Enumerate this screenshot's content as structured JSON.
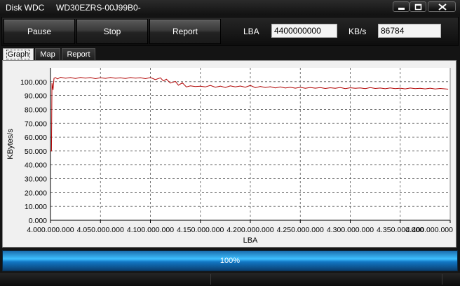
{
  "window": {
    "title": "Disk WDC     WD30EZRS-00J99B0-",
    "minimize_icon": "minimize-icon",
    "maximize_icon": "maximize-icon",
    "close_icon": "close-icon"
  },
  "toolbar": {
    "pause_label": "Pause",
    "stop_label": "Stop",
    "report_label": "Report",
    "lba_label": "LBA",
    "lba_value": "4400000000",
    "kbs_label": "KB/s",
    "kbs_value": "86784"
  },
  "tabs": [
    {
      "label": "Graph",
      "active": true
    },
    {
      "label": "Map",
      "active": false
    },
    {
      "label": "Report",
      "active": false
    }
  ],
  "chart_data": {
    "type": "line",
    "title": "",
    "xlabel": "LBA",
    "ylabel": "KBytes/s",
    "xlim": [
      4000000000,
      4400000000
    ],
    "ylim": [
      0,
      110000
    ],
    "grid": true,
    "x_tick_labels": [
      "4.000.000.000",
      "4.050.000.000",
      "4.100.000.000",
      "4.150.000.000",
      "4.200.000.000",
      "4.250.000.000",
      "4.300.000.000",
      "4.350.000.000",
      "4.400.000.000"
    ],
    "y_tick_labels": [
      "0.000",
      "10.000",
      "20.000",
      "30.000",
      "40.000",
      "50.000",
      "60.000",
      "70.000",
      "80.000",
      "90.000",
      "100.000"
    ],
    "line_color": "#b00000",
    "series": [
      {
        "x": [
          4000000000,
          4001000000,
          4001500000,
          4002500000,
          4003500000,
          4005000000,
          4007000000,
          4010000000,
          4015000000,
          4020000000,
          4025000000,
          4030000000,
          4035000000,
          4040000000,
          4045000000,
          4050000000,
          4055000000,
          4060000000,
          4065000000,
          4070000000,
          4075000000,
          4080000000,
          4085000000,
          4090000000,
          4095000000,
          4100000000,
          4105000000,
          4110000000,
          4113000000,
          4116000000,
          4120000000,
          4125000000,
          4128000000,
          4132000000,
          4136000000,
          4140000000,
          4145000000,
          4150000000,
          4155000000,
          4160000000,
          4165000000,
          4170000000,
          4175000000,
          4180000000,
          4185000000,
          4190000000,
          4195000000,
          4200000000,
          4205000000,
          4210000000,
          4215000000,
          4220000000,
          4225000000,
          4230000000,
          4235000000,
          4240000000,
          4245000000,
          4250000000,
          4255000000,
          4260000000,
          4265000000,
          4270000000,
          4275000000,
          4280000000,
          4285000000,
          4290000000,
          4295000000,
          4300000000,
          4305000000,
          4310000000,
          4315000000,
          4320000000,
          4325000000,
          4330000000,
          4335000000,
          4340000000,
          4345000000,
          4350000000,
          4355000000,
          4360000000,
          4365000000,
          4370000000,
          4375000000,
          4380000000,
          4385000000,
          4390000000,
          4395000000,
          4398000000
        ],
        "y": [
          50000,
          50000,
          99000,
          94000,
          102500,
          103000,
          102000,
          103200,
          102500,
          103000,
          102300,
          103100,
          102600,
          103000,
          102200,
          102900,
          102400,
          103100,
          102500,
          102800,
          102300,
          103000,
          102600,
          102900,
          102200,
          103000,
          101500,
          102800,
          100500,
          101800,
          99000,
          100200,
          97500,
          99200,
          96200,
          97000,
          96500,
          96800,
          96200,
          97300,
          96000,
          96800,
          95800,
          97000,
          96200,
          96900,
          96000,
          97300,
          95700,
          96600,
          95800,
          96400,
          95500,
          96200,
          95400,
          96000,
          95300,
          95900,
          95200,
          95800,
          95300,
          95700,
          95100,
          95600,
          95200,
          95800,
          95000,
          95600,
          95200,
          95500,
          95000,
          95700,
          95100,
          95400,
          94900,
          95500,
          95000,
          95300,
          94800,
          95400,
          95000,
          95200,
          94800,
          95300,
          94700,
          95100,
          94800,
          94600
        ]
      }
    ]
  },
  "progress": {
    "percent": 100,
    "label": "100%"
  }
}
